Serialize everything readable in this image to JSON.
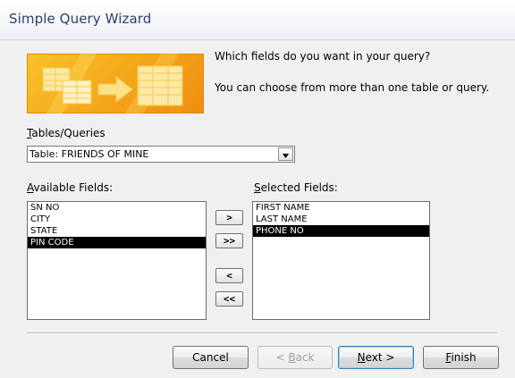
{
  "window": {
    "title": "Simple Query Wizard"
  },
  "prompt": {
    "line1": "Which fields do you want in your query?",
    "line2": "You can choose from more than one table or query."
  },
  "tables_queries": {
    "label_accel": "T",
    "label_rest": "ables/Queries",
    "selected_value": "Table: FRIENDS OF MINE"
  },
  "available_fields": {
    "label_accel": "A",
    "label_rest": "vailable Fields:",
    "items": [
      "SN NO",
      "CITY",
      "STATE",
      "PIN CODE"
    ],
    "selected_item": "PIN CODE"
  },
  "selected_fields": {
    "label_accel": "S",
    "label_rest": "elected Fields:",
    "items": [
      "FIRST NAME",
      "LAST NAME",
      "PHONE NO"
    ],
    "selected_item": "PHONE NO"
  },
  "move_buttons": {
    "add_one": ">",
    "add_all": ">>",
    "remove_one": "<",
    "remove_all": "<<"
  },
  "footer_buttons": {
    "cancel": "Cancel",
    "back_prefix": "< ",
    "back_accel": "B",
    "back_rest": "ack",
    "next_accel": "N",
    "next_rest": "ext >",
    "finish_accel": "F",
    "finish_rest": "inish"
  },
  "colors": {
    "title_text": "#2a3f6e",
    "illustration_orange": "#f4a51a",
    "selection": "#000000"
  }
}
